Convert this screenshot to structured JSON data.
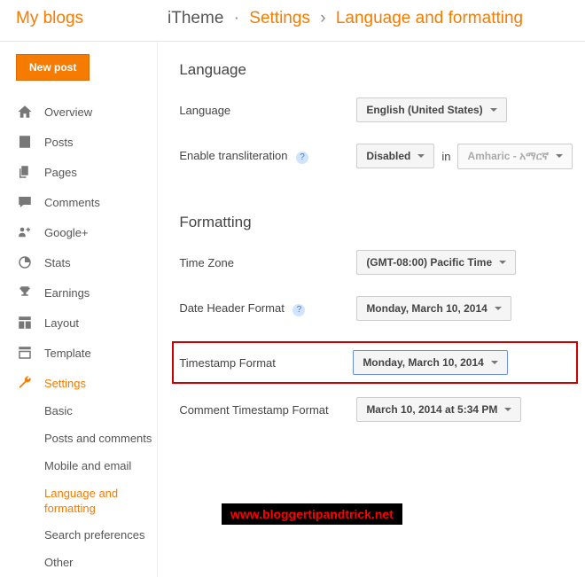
{
  "header": {
    "title": "My blogs",
    "breadcrumb": {
      "blog": "iTheme",
      "section": "Settings",
      "page": "Language and formatting"
    }
  },
  "sidebar": {
    "new_post": "New post",
    "items": [
      {
        "label": "Overview"
      },
      {
        "label": "Posts"
      },
      {
        "label": "Pages"
      },
      {
        "label": "Comments"
      },
      {
        "label": "Google+"
      },
      {
        "label": "Stats"
      },
      {
        "label": "Earnings"
      },
      {
        "label": "Layout"
      },
      {
        "label": "Template"
      },
      {
        "label": "Settings"
      }
    ],
    "sub_items": [
      {
        "label": "Basic"
      },
      {
        "label": "Posts and comments"
      },
      {
        "label": "Mobile and email"
      },
      {
        "label": "Language and formatting"
      },
      {
        "label": "Search preferences"
      },
      {
        "label": "Other"
      }
    ]
  },
  "main": {
    "language_section": "Language",
    "language_label": "Language",
    "language_value": "English (United States)",
    "translit_label": "Enable transliteration",
    "translit_value": "Disabled",
    "translit_in": "in",
    "translit_lang": "Amharic - አማርኛ",
    "formatting_section": "Formatting",
    "timezone_label": "Time Zone",
    "timezone_value": "(GMT-08:00) Pacific Time",
    "dateheader_label": "Date Header Format",
    "dateheader_value": "Monday, March 10, 2014",
    "timestamp_label": "Timestamp Format",
    "timestamp_value": "Monday, March 10, 2014",
    "comment_ts_label": "Comment Timestamp Format",
    "comment_ts_value": "March 10, 2014 at 5:34 PM"
  },
  "watermark": "www.bloggertipandtrick.net"
}
